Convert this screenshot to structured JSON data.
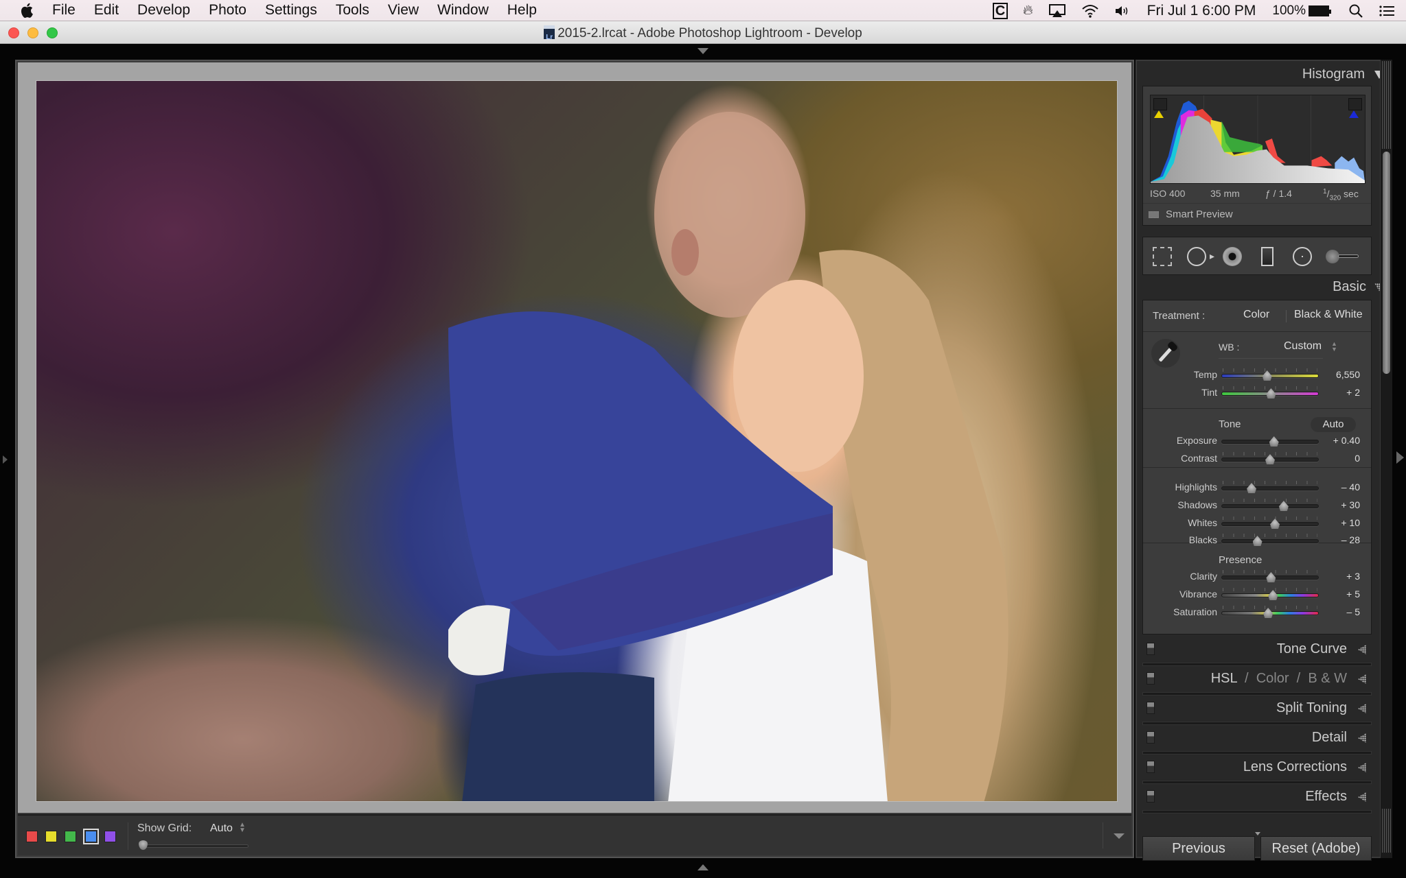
{
  "menubar": {
    "app_name": "Lightroom",
    "items": [
      "File",
      "Edit",
      "Develop",
      "Photo",
      "Settings",
      "Tools",
      "View",
      "Window",
      "Help"
    ],
    "status": {
      "clock": "Fri Jul 1  6:00 PM",
      "battery": "100%"
    },
    "icons": [
      "apple-icon",
      "clipboard-c-icon",
      "flame-icon",
      "airplay-icon",
      "wifi-icon",
      "volume-icon",
      "battery-charging-icon",
      "spotlight-search-icon",
      "notification-center-icon"
    ]
  },
  "window": {
    "title": "2015-2.lrcat - Adobe Photoshop Lightroom - Develop",
    "doc_icon_label": "Lr"
  },
  "toolbar": {
    "color_labels": [
      {
        "name": "red",
        "color": "#e84a4a",
        "selected": false
      },
      {
        "name": "yellow",
        "color": "#e6dd2c",
        "selected": false
      },
      {
        "name": "green",
        "color": "#43b84b",
        "selected": false
      },
      {
        "name": "blue",
        "color": "#4a8ef0",
        "selected": true
      },
      {
        "name": "purple",
        "color": "#9050e8",
        "selected": false
      }
    ],
    "show_grid_label": "Show Grid:",
    "show_grid_value": "Auto",
    "grid_opacity_fraction": 0.0
  },
  "histogram": {
    "title": "Histogram",
    "exif": {
      "iso": "ISO 400",
      "focal_length": "35 mm",
      "aperture": "ƒ / 1.4",
      "shutter_num": "1",
      "shutter_den": "320",
      "shutter_unit": "sec"
    },
    "smart_preview": "Smart Preview"
  },
  "basic": {
    "title": "Basic",
    "treatment_label": "Treatment :",
    "treatment_color": "Color",
    "treatment_bw": "Black & White",
    "wb_label": "WB :",
    "wb_value": "Custom",
    "tone_label": "Tone",
    "auto_label": "Auto",
    "presence_label": "Presence",
    "sliders": {
      "temp": {
        "label": "Temp",
        "value": "6,550",
        "position": 0.47
      },
      "tint": {
        "label": "Tint",
        "value": "+ 2",
        "position": 0.51
      },
      "exposure": {
        "label": "Exposure",
        "value": "+ 0.40",
        "position": 0.54
      },
      "contrast": {
        "label": "Contrast",
        "value": "0",
        "position": 0.5
      },
      "highlights": {
        "label": "Highlights",
        "value": "– 40",
        "position": 0.31
      },
      "shadows": {
        "label": "Shadows",
        "value": "+ 30",
        "position": 0.64
      },
      "whites": {
        "label": "Whites",
        "value": "+ 10",
        "position": 0.55
      },
      "blacks": {
        "label": "Blacks",
        "value": "– 28",
        "position": 0.37
      },
      "clarity": {
        "label": "Clarity",
        "value": "+ 3",
        "position": 0.51
      },
      "vibrance": {
        "label": "Vibrance",
        "value": "+ 5",
        "position": 0.53
      },
      "saturation": {
        "label": "Saturation",
        "value": "– 5",
        "position": 0.48
      }
    }
  },
  "panels": {
    "tone_curve": "Tone Curve",
    "hsl": "HSL",
    "hsl_sep": "/",
    "color": "Color",
    "bw": "B & W",
    "split_toning": "Split Toning",
    "detail": "Detail",
    "lens_corrections": "Lens Corrections",
    "effects": "Effects"
  },
  "buttons": {
    "previous": "Previous",
    "reset": "Reset (Adobe)"
  },
  "photo": {
    "description": "Couple embracing outdoors, man kissing woman's forehead"
  }
}
